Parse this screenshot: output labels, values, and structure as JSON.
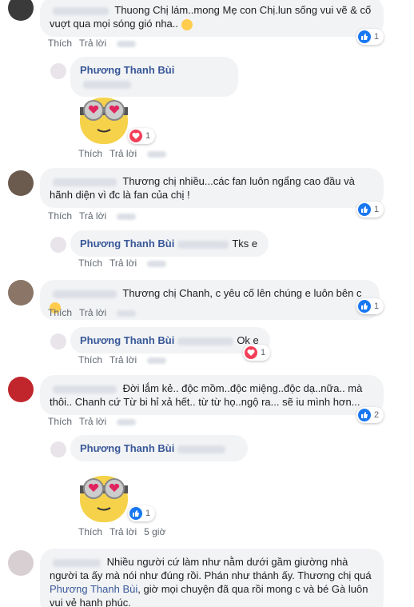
{
  "reply_author": "Phương Thanh Bùi",
  "actions": {
    "like": "Thích",
    "reply": "Trả lời"
  },
  "comments": [
    {
      "text": "Thuong Chị lám..mong Mẹ con Chị.lun sống vui vẽ & cố vuợt qua mọi sóng gió nha..",
      "likes": "1"
    },
    {
      "likes": "1"
    },
    {
      "text": "Thương chị nhiều...các fan luôn ngẩng cao đầu và hãnh diện vì đc là fan của chị !",
      "likes": "1"
    },
    {
      "text": "Tks e"
    },
    {
      "text": "Thương chị Chanh, c yêu cố lên chúng e luôn bên c",
      "likes": "1"
    },
    {
      "text": "Ok e",
      "likes": "1"
    },
    {
      "text": "Đời lắm kẻ.. độc mồm..độc miệng..độc dạ..nữa.. mà thôi.. Chanh cứ Từ bi hỉ xả hết.. từ từ họ..ngộ ra... sẽ iu mình hơn...",
      "likes": "2"
    },
    {
      "likes": "1",
      "time": "5 giờ"
    },
    {
      "text_a": "Nhiều người cứ làm như nằm dưới gầm giường nhà người ta ấy mà nói như đúng rồi. Phán như thánh ấy. Thương chị quá",
      "mention": "Phương Thanh Bùi",
      "text_b": ", giờ mọi chuyện đã qua rồi mong c và bé Gà luôn vui vẻ hạnh phúc."
    }
  ],
  "colors": {
    "link": "#385898",
    "bubble": "#f2f3f5",
    "like": "#1877f2",
    "heart": "#f33e58"
  }
}
